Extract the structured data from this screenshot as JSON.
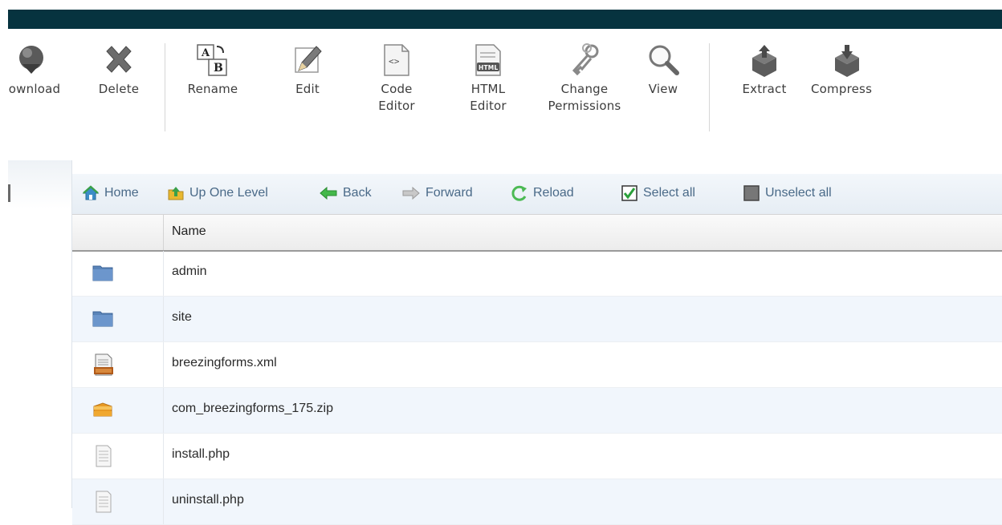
{
  "toolbar": {
    "buttons": [
      {
        "id": "download",
        "label": "ownload",
        "icon": "globe-download-icon"
      },
      {
        "id": "delete",
        "label": "Delete",
        "icon": "delete-x-icon"
      },
      {
        "id": "rename",
        "label": "Rename",
        "icon": "rename-ab-icon"
      },
      {
        "id": "edit",
        "label": "Edit",
        "icon": "pencil-icon"
      },
      {
        "id": "code_editor",
        "label_line1": "Code",
        "label_line2": "Editor",
        "icon": "code-file-icon"
      },
      {
        "id": "html_editor",
        "label_line1": "HTML",
        "label_line2": "Editor",
        "icon": "html-file-icon"
      },
      {
        "id": "change_permissions",
        "label_line1": "Change",
        "label_line2": "Permissions",
        "icon": "keys-icon"
      },
      {
        "id": "view",
        "label": "View",
        "icon": "magnifier-icon"
      },
      {
        "id": "extract",
        "label": "Extract",
        "icon": "box-extract-icon"
      },
      {
        "id": "compress",
        "label": "Compress",
        "icon": "box-compress-icon"
      }
    ]
  },
  "nav": {
    "home": "Home",
    "up_one_level": "Up One Level",
    "back": "Back",
    "forward": "Forward",
    "reload": "Reload",
    "select_all": "Select all",
    "unselect_all": "Unselect all"
  },
  "table": {
    "header_name": "Name",
    "rows": [
      {
        "name": "admin",
        "icon": "folder-icon"
      },
      {
        "name": "site",
        "icon": "folder-icon"
      },
      {
        "name": "breezingforms.xml",
        "icon": "xml-file-icon"
      },
      {
        "name": "com_breezingforms_175.zip",
        "icon": "zip-archive-icon"
      },
      {
        "name": "install.php",
        "icon": "text-file-icon"
      },
      {
        "name": "uninstall.php",
        "icon": "text-file-icon"
      }
    ]
  },
  "colors": {
    "topbar": "#06333f",
    "nav_text": "#4a6a88",
    "row_alt": "#f1f6fc",
    "folder": "#5a84b8"
  }
}
